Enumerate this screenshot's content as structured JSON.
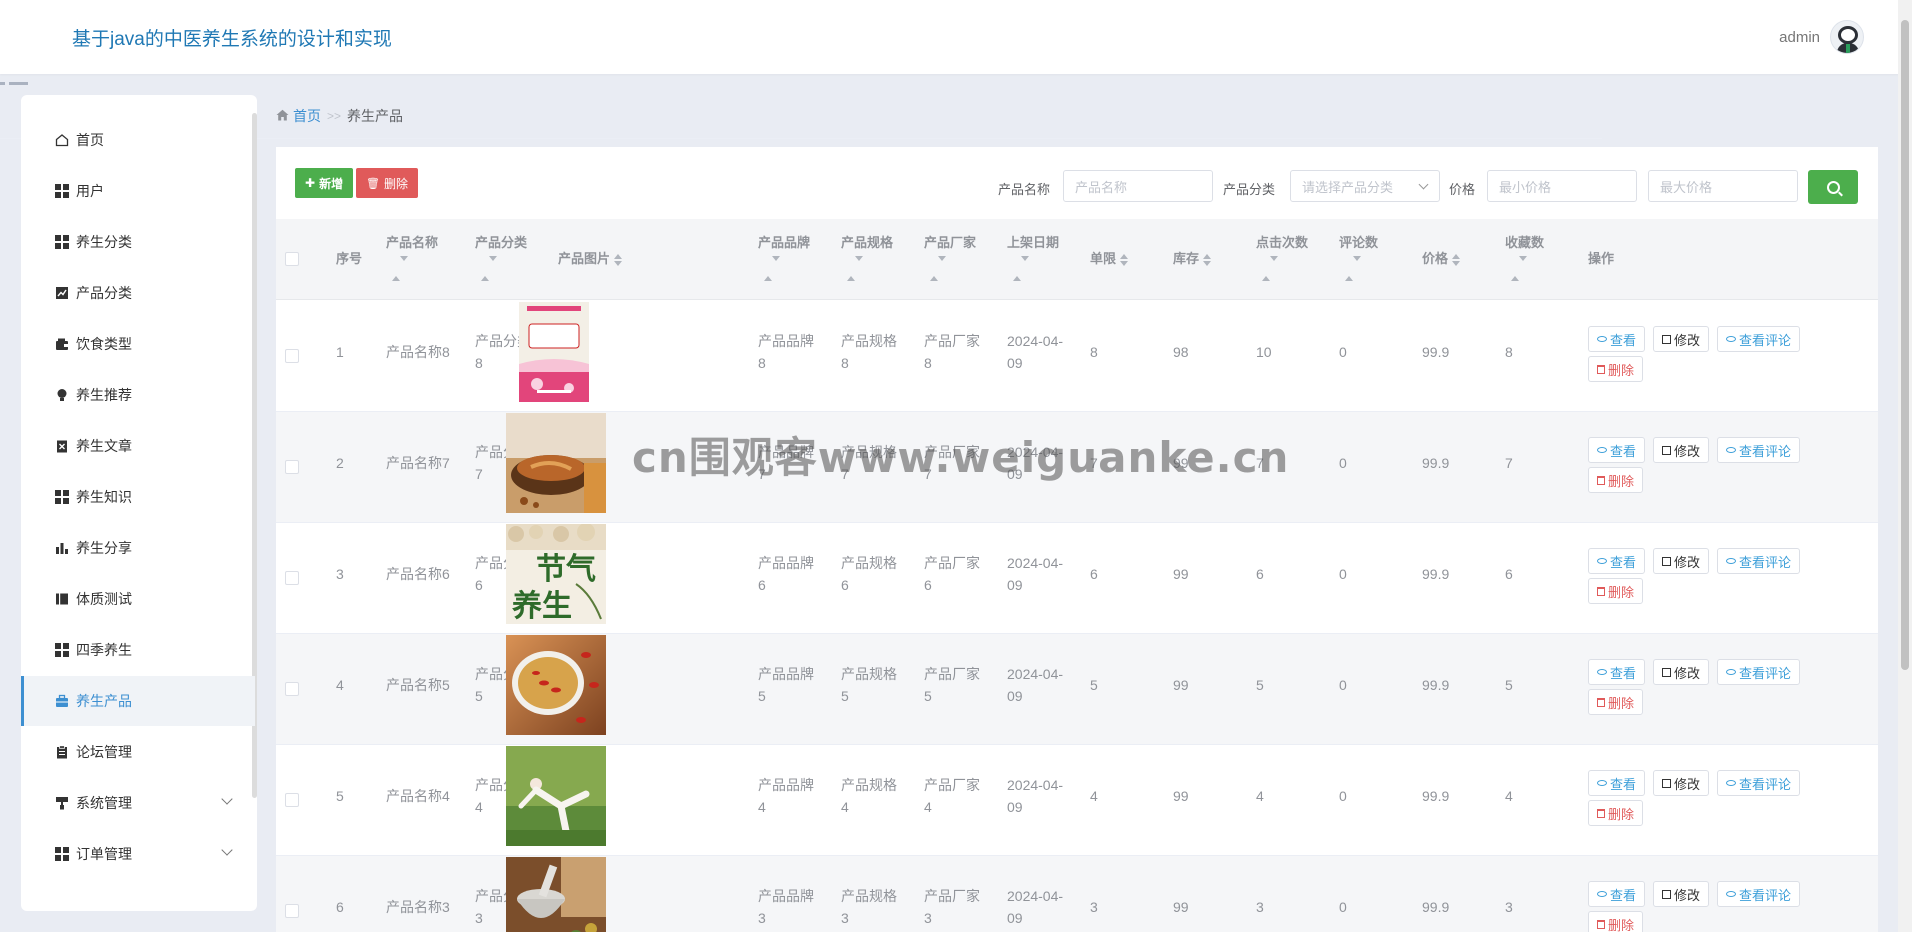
{
  "header": {
    "title": "基于java的中医养生系统的设计和实现",
    "username": "admin"
  },
  "breadcrumb": {
    "home": "首页",
    "separator": ">>",
    "current": "养生产品"
  },
  "sidebar": {
    "items": [
      {
        "label": "首页",
        "icon": "home-icon"
      },
      {
        "label": "用户",
        "icon": "grid-icon"
      },
      {
        "label": "养生分类",
        "icon": "grid-icon"
      },
      {
        "label": "产品分类",
        "icon": "line-chart-icon"
      },
      {
        "label": "饮食类型",
        "icon": "wallet-icon"
      },
      {
        "label": "养生推荐",
        "icon": "lightbulb-icon"
      },
      {
        "label": "养生文章",
        "icon": "clipboard-x-icon"
      },
      {
        "label": "养生知识",
        "icon": "grid-icon"
      },
      {
        "label": "养生分享",
        "icon": "bar-chart-icon"
      },
      {
        "label": "体质测试",
        "icon": "book-icon"
      },
      {
        "label": "四季养生",
        "icon": "grid-icon"
      },
      {
        "label": "养生产品",
        "icon": "briefcase-icon",
        "active": true
      },
      {
        "label": "论坛管理",
        "icon": "clipboard-icon"
      },
      {
        "label": "系统管理",
        "icon": "paint-roller-icon",
        "expandable": true
      },
      {
        "label": "订单管理",
        "icon": "grid-icon",
        "expandable": true
      }
    ]
  },
  "toolbar": {
    "add_label": "新增",
    "delete_label": "删除"
  },
  "search": {
    "name_label": "产品名称",
    "name_placeholder": "产品名称",
    "category_label": "产品分类",
    "category_placeholder": "请选择产品分类",
    "price_label": "价格",
    "min_placeholder": "最小价格",
    "max_placeholder": "最大价格"
  },
  "table": {
    "columns": [
      "序号",
      "产品名称",
      "产品分类",
      "产品图片",
      "产品品牌",
      "产品规格",
      "产品厂家",
      "上架日期",
      "单限",
      "库存",
      "点击次数",
      "评论数",
      "价格",
      "收藏数",
      "操作"
    ],
    "actions": {
      "view": "查看",
      "edit": "修改",
      "reviews": "查看评论",
      "delete": "删除"
    },
    "rows": [
      {
        "no": "1",
        "name": "产品名称8",
        "category": [
          "产品分类",
          "8"
        ],
        "brand": [
          "产品品牌",
          "8"
        ],
        "spec": [
          "产品规格",
          "8"
        ],
        "maker": [
          "产品厂家",
          "8"
        ],
        "date": [
          "2024-04-",
          "09"
        ],
        "limit": "8",
        "stock": "98",
        "clicks": "10",
        "comments": "0",
        "price": "99.9",
        "favorites": "8",
        "image": "book-cover-image"
      },
      {
        "no": "2",
        "name": "产品名称7",
        "category": [
          "产品分类",
          "7"
        ],
        "brand": [
          "产品品牌",
          "7"
        ],
        "spec": [
          "产品规格",
          "7"
        ],
        "maker": [
          "产品厂家",
          "7"
        ],
        "date": [
          "2024-04-",
          "09"
        ],
        "limit": "7",
        "stock": "99",
        "clicks": "7",
        "comments": "0",
        "price": "99.9",
        "favorites": "7",
        "image": "herbal-bowl-image"
      },
      {
        "no": "3",
        "name": "产品名称6",
        "category": [
          "产品分类",
          "6"
        ],
        "brand": [
          "产品品牌",
          "6"
        ],
        "spec": [
          "产品规格",
          "6"
        ],
        "maker": [
          "产品厂家",
          "6"
        ],
        "date": [
          "2024-04-",
          "09"
        ],
        "limit": "6",
        "stock": "99",
        "clicks": "6",
        "comments": "0",
        "price": "99.9",
        "favorites": "6",
        "image": "solar-term-image",
        "image_text": [
          "节气",
          "养生"
        ]
      },
      {
        "no": "4",
        "name": "产品名称5",
        "category": [
          "产品分类",
          "5"
        ],
        "brand": [
          "产品品牌",
          "5"
        ],
        "spec": [
          "产品规格",
          "5"
        ],
        "maker": [
          "产品厂家",
          "5"
        ],
        "date": [
          "2024-04-",
          "09"
        ],
        "limit": "5",
        "stock": "99",
        "clicks": "5",
        "comments": "0",
        "price": "99.9",
        "favorites": "5",
        "image": "goji-tea-image"
      },
      {
        "no": "5",
        "name": "产品名称4",
        "category": [
          "产品分类",
          "4"
        ],
        "brand": [
          "产品品牌",
          "4"
        ],
        "spec": [
          "产品规格",
          "4"
        ],
        "maker": [
          "产品厂家",
          "4"
        ],
        "date": [
          "2024-04-",
          "09"
        ],
        "limit": "4",
        "stock": "99",
        "clicks": "4",
        "comments": "0",
        "price": "99.9",
        "favorites": "4",
        "image": "yoga-image"
      },
      {
        "no": "6",
        "name": "产品名称3",
        "category": [
          "产品分类",
          "3"
        ],
        "brand": [
          "产品品牌",
          "3"
        ],
        "spec": [
          "产品规格",
          "3"
        ],
        "maker": [
          "产品厂家",
          "3"
        ],
        "date": [
          "2024-04-",
          "09"
        ],
        "limit": "3",
        "stock": "99",
        "clicks": "3",
        "comments": "0",
        "price": "99.9",
        "favorites": "3",
        "image": "mortar-herbs-image"
      }
    ]
  },
  "watermark": "cn围观客www.weiguanke.cn",
  "colors": {
    "accent": "#3d8fd1",
    "add": "#4cae4c",
    "danger": "#e05a5a"
  }
}
